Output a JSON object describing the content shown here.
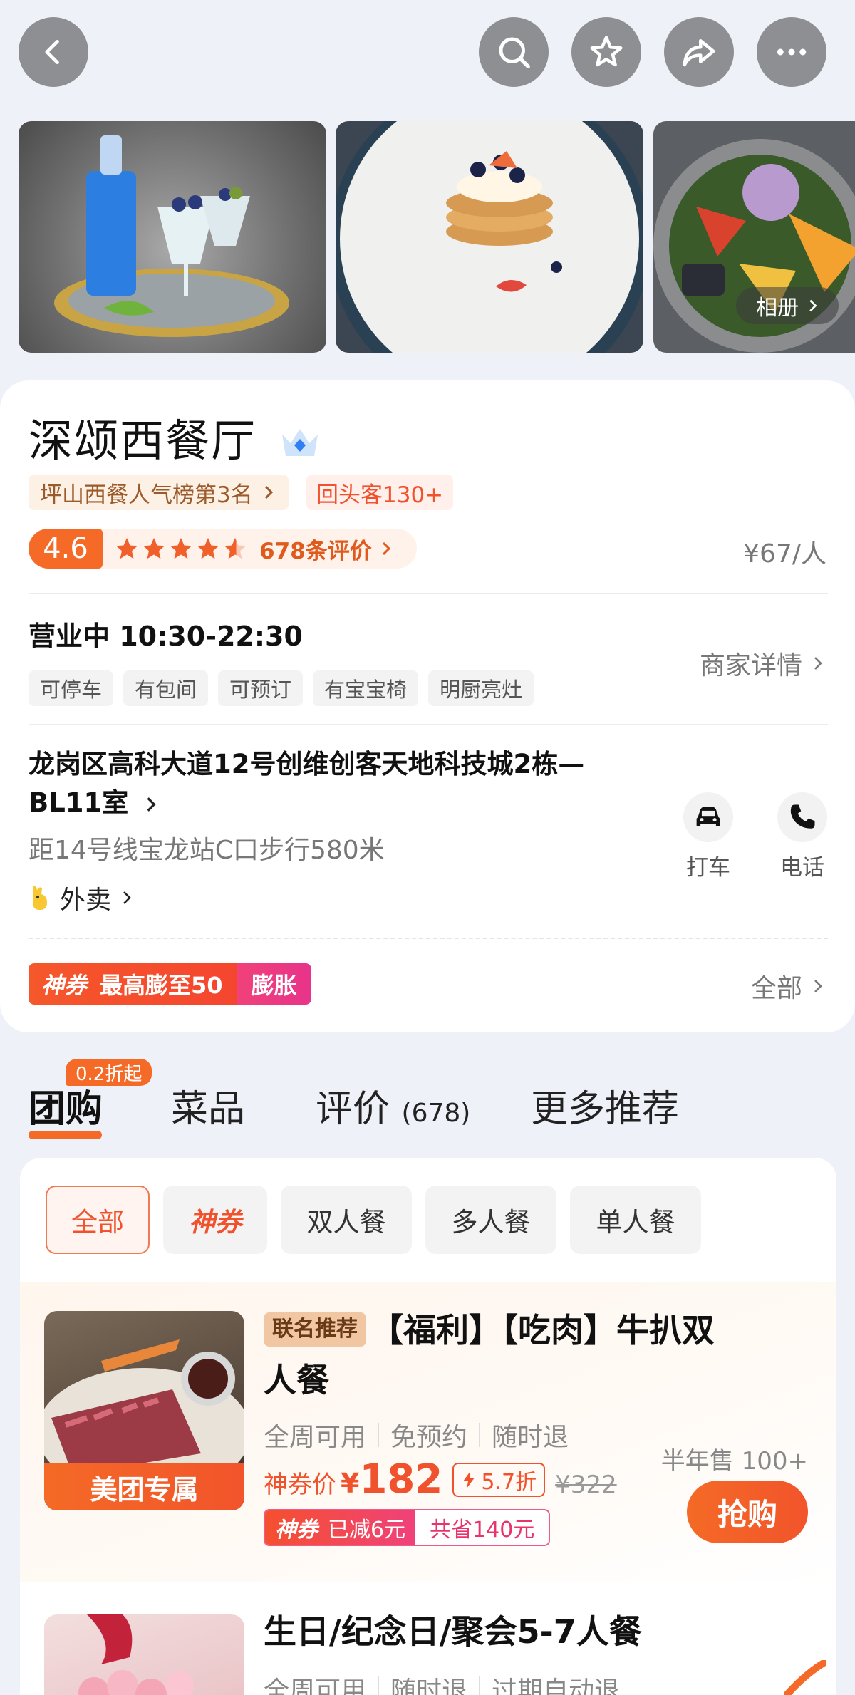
{
  "nav": {
    "back_icon": "chevron-left-icon",
    "search_icon": "search-icon",
    "favorite_icon": "star-icon",
    "share_icon": "share-icon",
    "more_icon": "more-icon"
  },
  "gallery": {
    "photos": [
      "drinks-photo",
      "dessert-photo",
      "salad-photo"
    ],
    "album_label": "相册"
  },
  "shop": {
    "name": "深颂西餐厅",
    "rank_tag": "坪山西餐人气榜第3名",
    "return_tag": "回头客130+",
    "rating": "4.6",
    "review_count": "678条评价",
    "price_per_person": "¥67/人",
    "stars": 4.5,
    "open_status": "营业中 10:30-22:30",
    "features": [
      "可停车",
      "有包间",
      "可预订",
      "有宝宝椅",
      "明厨亮灶"
    ],
    "merchant_detail": "商家详情",
    "address": "龙岗区高科大道12号创维创客天地科技城2栋—BL11室",
    "distance": "距14号线宝龙站C口步行580米",
    "takeout": "外卖",
    "actions": [
      {
        "label": "打车",
        "icon": "car-icon"
      },
      {
        "label": "电话",
        "icon": "phone-icon"
      }
    ]
  },
  "coupon": {
    "badge": "神券",
    "text": "最高膨至50",
    "expand": "膨胀",
    "all_link": "全部"
  },
  "tabs": {
    "discount_bubble": "0.2折起",
    "group_buy": "团购",
    "dishes": "菜品",
    "reviews": "评价",
    "review_count": "(678)",
    "more": "更多推荐"
  },
  "filters": [
    "全部",
    "神券",
    "双人餐",
    "多人餐",
    "单人餐"
  ],
  "deals": [
    {
      "badge": "联名推荐",
      "title": "【福利】【吃肉】牛扒双人餐",
      "image_label": "美团专属",
      "tags": [
        "全周可用",
        "免预约",
        "随时退"
      ],
      "price_label": "神券价",
      "currency": "¥",
      "price": "182",
      "discount": "5.7折",
      "original_price": "¥322",
      "coupon_badge": "神券",
      "coupon_reduced": "已减6元",
      "total_saved": "共省140元",
      "sold": "半年售 100+",
      "buy_label": "抢购"
    },
    {
      "title": "生日/纪念日/聚会5-7人餐",
      "tags": [
        "全周可用",
        "随时退",
        "过期自动退"
      ]
    }
  ],
  "colors": {
    "accent": "#f46a26",
    "price": "#f0522d",
    "coupon_pink": "#e8338a"
  }
}
